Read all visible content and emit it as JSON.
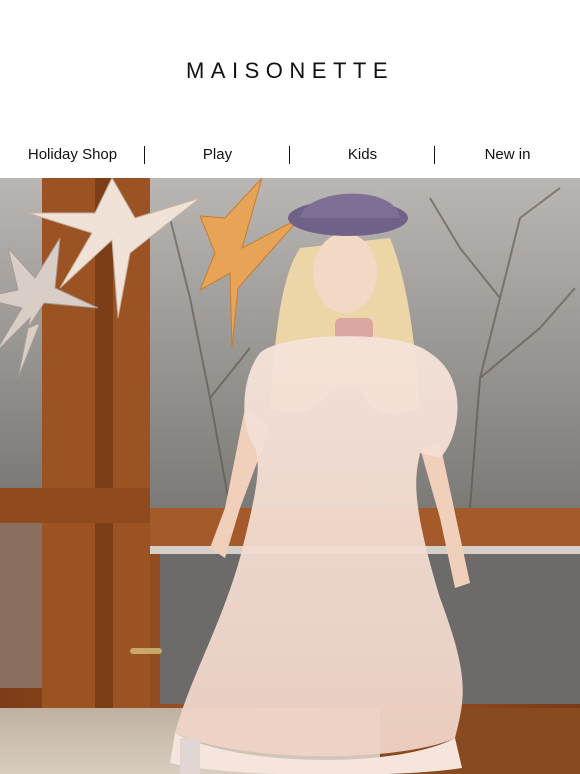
{
  "brand": {
    "logo_text": "MAISONETTE"
  },
  "nav": {
    "items": [
      {
        "label": "Holiday Shop"
      },
      {
        "label": "Play"
      },
      {
        "label": "Kids"
      },
      {
        "label": "New in"
      }
    ]
  },
  "colors": {
    "wood": "#9a4f22",
    "glass": "#8f8d8a",
    "star_light": "#e9d5c4",
    "star_gold": "#e8a456",
    "hat": "#7e6f95",
    "dress": "#f3ddd3",
    "hair": "#ecd6a7"
  }
}
